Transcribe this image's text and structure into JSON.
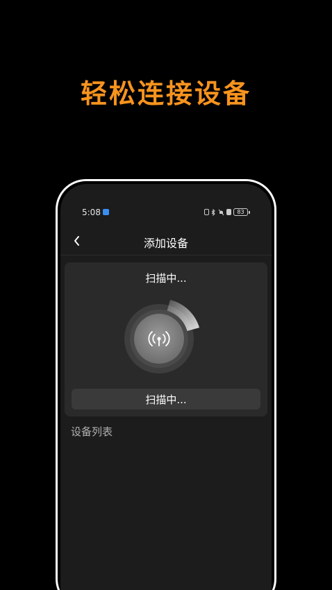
{
  "promo": {
    "headline": "轻松连接设备",
    "accent_color": "#f7931e"
  },
  "status_bar": {
    "time": "5:08",
    "battery_level": "83",
    "icons": [
      "app-notification-icon",
      "nfc-icon",
      "bluetooth-icon",
      "mute-icon",
      "sim-icon",
      "battery-icon"
    ]
  },
  "nav": {
    "back_icon": "chevron-left-icon",
    "title": "添加设备"
  },
  "scan_card": {
    "status_text": "扫描中...",
    "center_icon": "broadcast-antenna-icon",
    "button_label": "扫描中..."
  },
  "device_list": {
    "label": "设备列表",
    "items": []
  }
}
